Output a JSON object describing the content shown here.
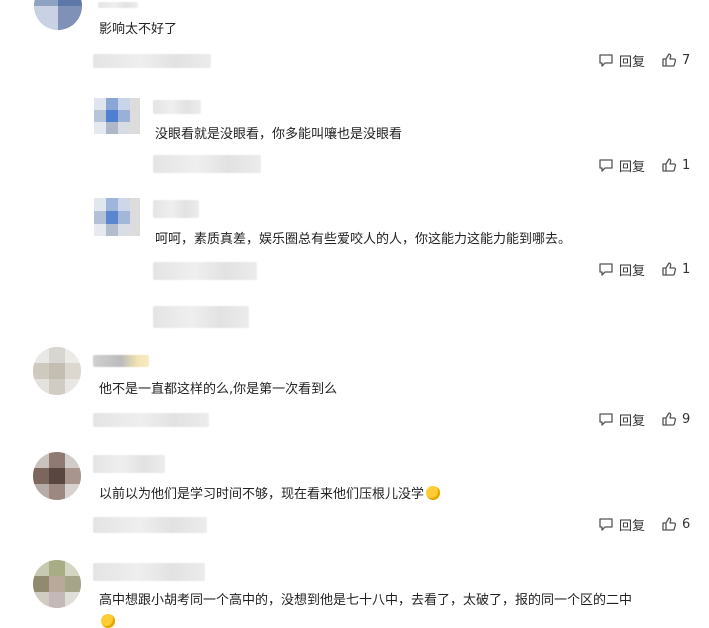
{
  "labels": {
    "reply": "回复"
  },
  "comments": [
    {
      "text": "影响太不好了",
      "likes": "7"
    },
    {
      "text": "没眼看就是没眼看，你多能叫嚷也是没眼看",
      "likes": "1"
    },
    {
      "text": "呵呵，素质真差，娱乐圈总有些爱咬人的人，你这能力这能力能到哪去。",
      "likes": "1"
    },
    {
      "text": "他不是一直都这样的么,你是第一次看到么",
      "likes": "9"
    },
    {
      "text": "以前以为他们是学习时间不够，现在看来他们压根儿没学",
      "likes": "6"
    },
    {
      "text": "高中想跟小胡考同一个高中的，没想到他是七十八中，去看了，太破了，报的同一个区的二中"
    }
  ],
  "icons": {
    "reply": "comment-bubble-icon",
    "like": "thumbs-up-icon",
    "emoji": "laughing-emoji-icon"
  }
}
